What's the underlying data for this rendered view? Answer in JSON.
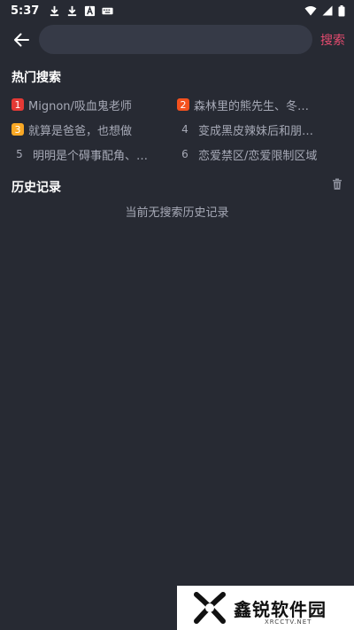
{
  "status_bar": {
    "time": "5:37",
    "icons_left": [
      "download-icon",
      "download-icon",
      "app-a-icon",
      "keyboard-icon"
    ],
    "icons_right": [
      "wifi-icon",
      "signal-icon",
      "battery-icon"
    ]
  },
  "search": {
    "placeholder": "",
    "value": "",
    "button_label": "搜索"
  },
  "hot": {
    "title": "热门搜索",
    "items": [
      {
        "rank": "1",
        "text": "Mignon/吸血鬼老师",
        "color": "#e53935"
      },
      {
        "rank": "2",
        "text": "森林里的熊先生、冬…",
        "color": "#f4511e"
      },
      {
        "rank": "3",
        "text": "就算是爸爸，也想做",
        "color": "#f9a825"
      },
      {
        "rank": "4",
        "text": "变成黑皮辣妹后和朋…",
        "color": ""
      },
      {
        "rank": "5",
        "text": "明明是个碍事配角、…",
        "color": ""
      },
      {
        "rank": "6",
        "text": "恋爱禁区/恋爱限制区域",
        "color": ""
      }
    ]
  },
  "history": {
    "title": "历史记录",
    "empty_text": "当前无搜索历史记录"
  },
  "watermark": {
    "text": "鑫锐软件园",
    "sub": "XRCCTV.NET"
  },
  "colors": {
    "background": "#272a33",
    "search_box": "#363a47",
    "accent": "#e34b6f",
    "muted_text": "#a6a9b6"
  }
}
